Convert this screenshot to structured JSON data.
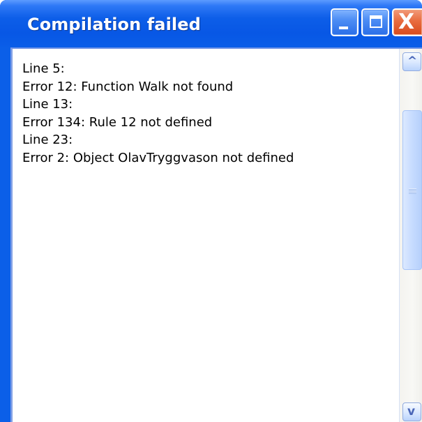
{
  "window": {
    "title": "Compilation failed",
    "accent_color": "#0b5fe8",
    "close_color": "#e46a3f"
  },
  "controls": {
    "minimize_icon": "minimize-icon",
    "maximize_icon": "maximize-icon",
    "close_icon": "close-icon",
    "close_symbol": "X"
  },
  "message": {
    "lines": [
      "Line 5:",
      "Error 12: Function Walk not found",
      "Line 13:",
      "Error 134: Rule 12 not defined",
      "Line 23:",
      "Error 2: Object OlavTryggvason not defined"
    ]
  },
  "scrollbar": {
    "up_icon": "chevron-up-icon",
    "down_icon": "chevron-down-icon",
    "up_symbol": "^",
    "down_symbol": "v"
  }
}
